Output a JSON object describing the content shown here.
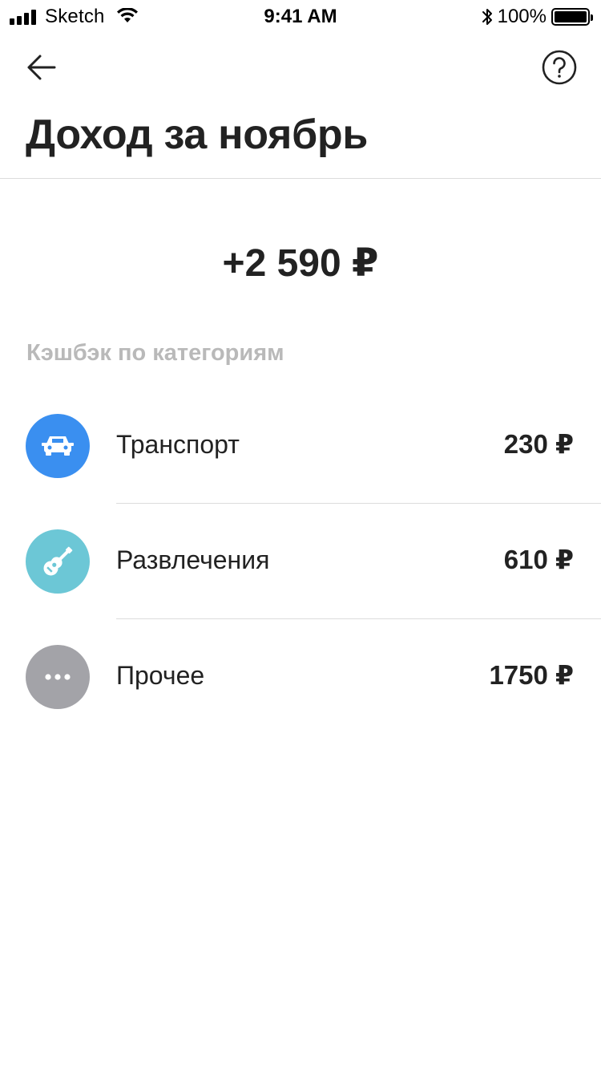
{
  "status_bar": {
    "carrier": "Sketch",
    "time": "9:41 AM",
    "battery": "100%"
  },
  "header": {
    "title": "Доход за ноябрь"
  },
  "summary": {
    "total": "+2 590 ₽"
  },
  "cashback": {
    "section_label": "Кэшбэк по категориям",
    "items": [
      {
        "name": "Транспорт",
        "amount": "230 ₽",
        "icon": "car-icon",
        "color": "#3a8ff0"
      },
      {
        "name": "Развлечения",
        "amount": "610 ₽",
        "icon": "guitar-icon",
        "color": "#6cc7d6"
      },
      {
        "name": "Прочее",
        "amount": "1750 ₽",
        "icon": "more-icon",
        "color": "#a3a3a8"
      }
    ]
  }
}
